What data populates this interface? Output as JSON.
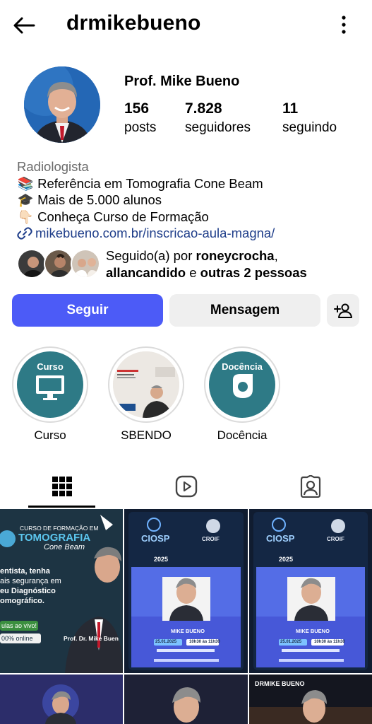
{
  "header": {
    "username": "drmikebueno"
  },
  "profile": {
    "full_name": "Prof. Mike Bueno",
    "stats": [
      {
        "value": "156",
        "label": "posts"
      },
      {
        "value": "7.828",
        "label": "seguidores"
      },
      {
        "value": "11",
        "label": "seguindo"
      }
    ],
    "category": "Radiologista",
    "bio_lines": [
      {
        "emoji": "📚",
        "text": "Referência em Tomografia Cone Beam"
      },
      {
        "emoji": "🎓",
        "text": "Mais de 5.000 alunos"
      },
      {
        "emoji": "👇🏻",
        "text": "Conheça Curso de Formação"
      }
    ],
    "link": "mikebueno.com.br/inscricao-aula-magna/",
    "followed_by": {
      "prefix": "Seguido(a) por ",
      "user1": "roneycrocha",
      "sep": ",",
      "user2": "allancandido",
      "mid": " e ",
      "others": "outras 2 pessoas"
    }
  },
  "buttons": {
    "follow": "Seguir",
    "message": "Mensagem"
  },
  "highlights": [
    {
      "label": "Curso",
      "title": "Curso"
    },
    {
      "label": "SBENDO",
      "title": ""
    },
    {
      "label": "Docência",
      "title": "Docência"
    }
  ],
  "posts": [
    {
      "line1": "CURSO DE FORMAÇÃO EM",
      "line2": "TOMOGRAFIA",
      "line3": "Cone Beam",
      "body1": "entista, tenha",
      "body2": "ais segurança em",
      "body3": "eu Diagnóstico",
      "body4": "omográfico.",
      "live": "ulas ao vivo!",
      "online": "00% online",
      "signature": "Prof. Dr. Mike Buen"
    },
    {
      "brand": "CIOSP",
      "partner": "CROIF",
      "year": "2025",
      "name": "MIKE BUENO",
      "date": "25.01.2025",
      "time": "10h30 às 11h30"
    },
    {
      "brand": "CIOSP",
      "partner": "CROIF",
      "year": "2025",
      "name": "MIKE BUENO",
      "date": "25.01.2025",
      "time": "10h30 às 11h30"
    },
    {
      "caption": ""
    },
    {
      "caption": ""
    },
    {
      "caption": "DRMIKE BUENO"
    }
  ],
  "colors": {
    "primary": "#4c5bf7",
    "secondary_button": "#efefef",
    "link": "#1f3e8a",
    "highlight_bg": "#2e7a86"
  }
}
